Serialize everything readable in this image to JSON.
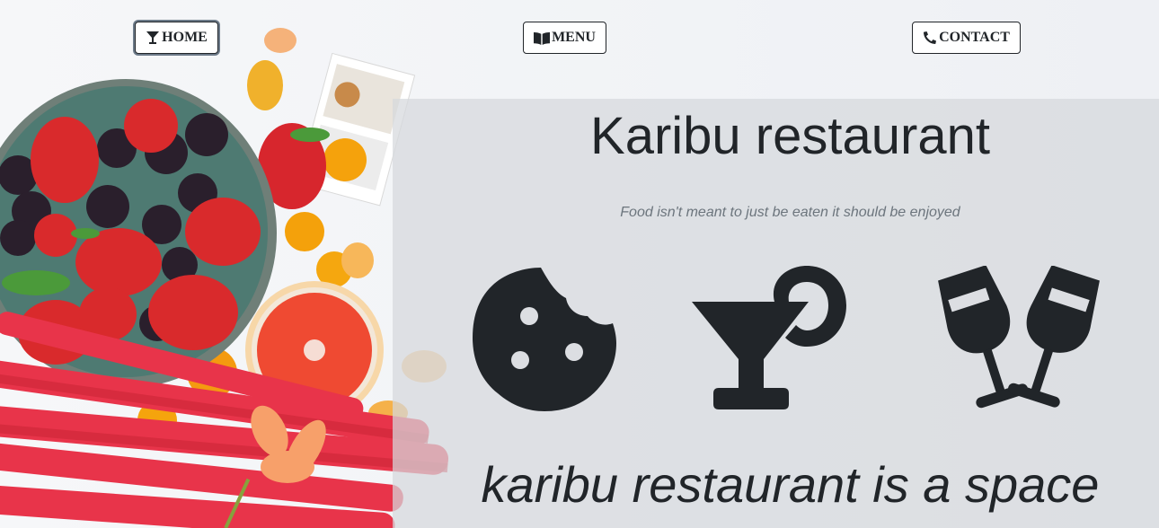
{
  "nav": {
    "home_label": "HOME",
    "menu_label": "MENU",
    "contact_label": "CONTACT"
  },
  "hero": {
    "title": "Karibu restaurant",
    "tagline": "Food isn't meant to just be eaten it should be enjoyed",
    "description": "karibu restaurant is a space"
  },
  "icons": [
    "cookie-icon",
    "cocktail-icon",
    "glass-cheers-icon"
  ],
  "colors": {
    "text": "#212529",
    "muted": "#6c757d",
    "panel": "#d6d8dc"
  }
}
